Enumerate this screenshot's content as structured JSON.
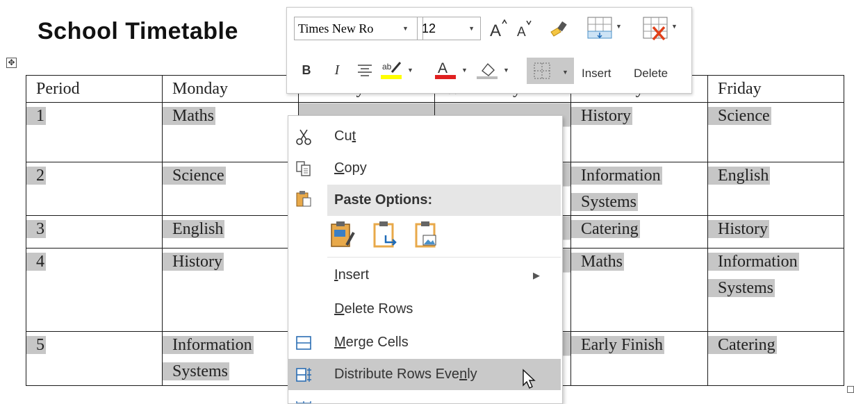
{
  "document": {
    "title": "School Timetable",
    "move_handle_glyph": "✥"
  },
  "timetable": {
    "headers": [
      "Period",
      "Monday",
      "Tuesday",
      "Wednesday",
      "Thursday",
      "Friday"
    ],
    "rows": [
      {
        "period": "1",
        "monday": "Maths",
        "thursday": "History",
        "friday": "Science"
      },
      {
        "period": "2",
        "monday": "Science",
        "thursday": "Information Systems",
        "friday": "English"
      },
      {
        "period": "3",
        "monday": "English",
        "thursday": "Catering",
        "friday": "History"
      },
      {
        "period": "4",
        "monday": "History",
        "thursday": "Maths",
        "friday": "Information Systems"
      },
      {
        "period": "5",
        "monday": "Information Systems",
        "thursday": "Early Finish",
        "friday": "Catering"
      }
    ]
  },
  "mini_toolbar": {
    "font_name": "Times New Ro",
    "font_size": "12",
    "bold": "B",
    "italic": "I",
    "insert_label": "Insert",
    "delete_label": "Delete"
  },
  "context_menu": {
    "cut": {
      "pre": "Cu",
      "key": "t",
      "post": ""
    },
    "copy": {
      "pre": "",
      "key": "C",
      "post": "opy"
    },
    "paste_options": "Paste Options:",
    "insert": {
      "pre": "",
      "key": "I",
      "post": "nsert"
    },
    "delete_rows": {
      "pre": "",
      "key": "D",
      "post": "elete Rows"
    },
    "merge_cells": {
      "pre": "",
      "key": "M",
      "post": "erge Cells"
    },
    "distribute_rows": {
      "pre": "Distribute Rows Eve",
      "key": "n",
      "post": "ly"
    }
  },
  "colors": {
    "highlight_yellow": "#ffff00",
    "font_color_red": "#e02020",
    "delete_x_red": "#e0401a",
    "shading_gray": "#c6c6c6"
  }
}
